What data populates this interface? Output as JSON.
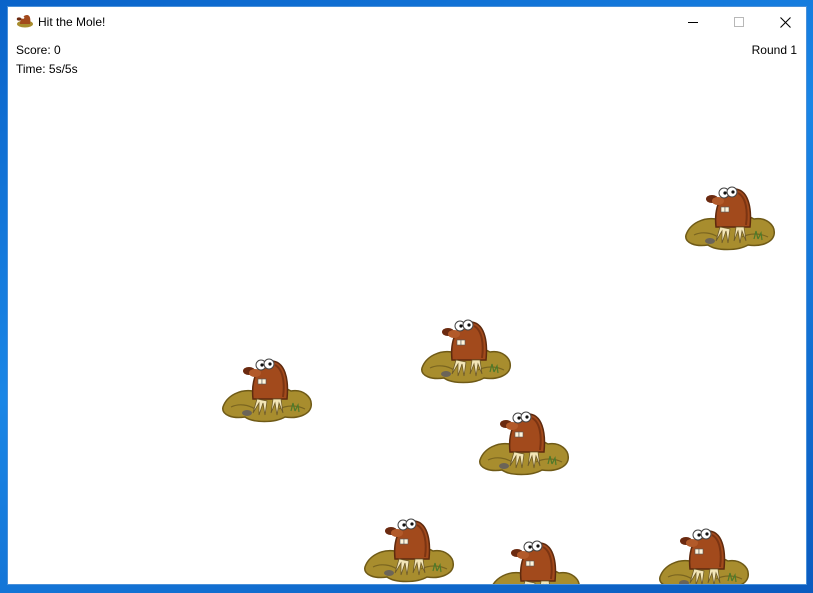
{
  "window": {
    "title": "Hit the Mole!"
  },
  "hud": {
    "score": "Score: 0",
    "time": "Time: 5s/5s",
    "round": "Round 1"
  },
  "icons": {
    "app": "mole-icon",
    "minimize": "minimize-icon",
    "maximize": "maximize-icon",
    "close": "close-icon"
  },
  "moles": [
    {
      "name": "mole-1"
    },
    {
      "name": "mole-2"
    },
    {
      "name": "mole-3"
    },
    {
      "name": "mole-4"
    },
    {
      "name": "mole-5"
    },
    {
      "name": "mole-6"
    },
    {
      "name": "mole-7"
    }
  ]
}
